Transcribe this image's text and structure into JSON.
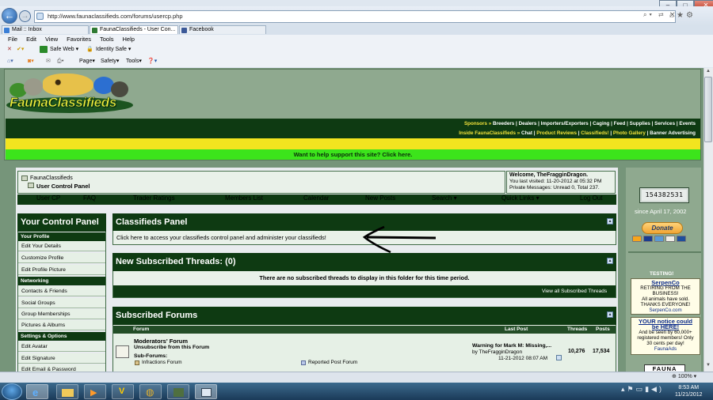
{
  "browser": {
    "url": "http://www.faunaclassifieds.com/forums/usercp.php",
    "tabs": [
      {
        "label": "Mail :: Inbox"
      },
      {
        "label": "FaunaClassifieds - User Con..."
      },
      {
        "label": "Facebook"
      }
    ],
    "menu": [
      "File",
      "Edit",
      "View",
      "Favorites",
      "Tools",
      "Help"
    ],
    "toolbar1": {
      "safe_web": "Safe Web",
      "identity_safe": "Identity Safe"
    },
    "toolbar2": {
      "page": "Page",
      "safety": "Safety",
      "tools": "Tools"
    },
    "zoom": "100%"
  },
  "site": {
    "logo": "FaunaClassifieds",
    "nav1_label": "Sponsors »",
    "nav1_links": [
      "Breeders",
      "Dealers",
      "Importers/Exporters",
      "Caging",
      "Feed",
      "Supplies",
      "Services",
      "Events"
    ],
    "nav2_label": "Inside FaunaClassifieds »",
    "nav2_links": [
      "Chat",
      "Product Reviews",
      "Classifieds!",
      "Photo Gallery",
      "Banner Advertising"
    ],
    "support_bar": "Want to help support this site? Click here."
  },
  "breadcrumb": {
    "root": "FaunaClassifieds",
    "current": "User Control Panel"
  },
  "welcome": {
    "greeting": "Welcome, TheFragginDragon.",
    "last_visited": "You last visited: 11-20-2012 at 05:32 PM",
    "pm": "Private Messages: Unread 0, Total 237."
  },
  "navstrip": [
    "User CP",
    "FAQ",
    "Trader Ratings",
    "Members List",
    "Calendar",
    "New Posts",
    "Search",
    "Quick Links",
    "Log Out"
  ],
  "sidebar": {
    "title": "Your Control Panel",
    "sections": [
      {
        "heading": "Your Profile",
        "items": [
          "Edit Your Details",
          "Customize Profile",
          "Edit Profile Picture"
        ]
      },
      {
        "heading": "Networking",
        "items": [
          "Contacts & Friends",
          "Social Groups",
          "Group Memberships",
          "Pictures & Albums"
        ]
      },
      {
        "heading": "Settings & Options",
        "items": [
          "Edit Avatar",
          "Edit Signature",
          "Edit Email & Password"
        ]
      }
    ]
  },
  "classifieds": {
    "title": "Classifieds Panel",
    "text": "Click here to access your classifieds control panel and administer your classifieds!"
  },
  "subscribed_threads": {
    "title": "New Subscribed Threads: (0)",
    "empty": "There are no subscribed threads to display in this folder for this time period.",
    "view_all": "View all Subscribed Threads"
  },
  "subscribed_forums": {
    "title": "Subscribed Forums",
    "columns": [
      "Forum",
      "Last Post",
      "Threads",
      "Posts"
    ],
    "rows": [
      {
        "forum": "Moderators' Forum",
        "unsubscribe": "Unsubscribe from this Forum",
        "subforums_label": "Sub-Forums:",
        "subforums": [
          "Infractions Forum",
          "Reported Post Forum"
        ],
        "last_post_title": "Warning for Mark M: Missing,...",
        "last_post_by": "by TheFragginDragon",
        "last_post_time": "11-21-2012 08:07 AM",
        "threads": "10,276",
        "posts": "17,534"
      }
    ]
  },
  "right": {
    "counter": "154382531",
    "since": "since April 17, 2002",
    "donate": "Donate",
    "testing": "TESTING!",
    "ad1": {
      "name": "SerpenCo",
      "l1": "RETIRING FROM THE",
      "l2": "BUSINESS!",
      "l3": "All animals have sold.",
      "l4": "THANKS EVERYONE!",
      "link": "SerpenCo.com"
    },
    "ad2": {
      "title1": "YOUR notice could",
      "title2": "be HERE!",
      "l1": "And be seen by 60,000+",
      "l2": "registered members! Only",
      "l3": "30 cents per day!",
      "link": "FaunaAds"
    },
    "footer_logo": "FAUNA"
  },
  "taskbar": {
    "time": "8:53 AM",
    "date": "11/21/2012"
  },
  "colors": {
    "forum_green": "#0e3a12",
    "page_bg": "#76957a",
    "yellow": "#f3e41f",
    "support_green": "#3ce41b"
  }
}
